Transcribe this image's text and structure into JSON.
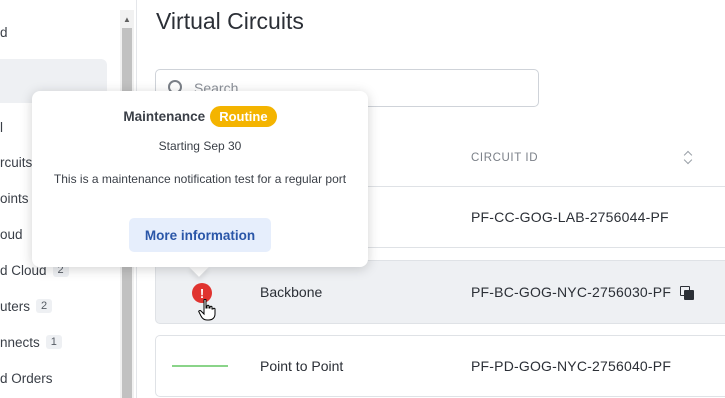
{
  "sidebar": {
    "items": [
      {
        "label": "d",
        "count": ""
      },
      {
        "label": "",
        "count": ""
      },
      {
        "label": "l",
        "count": ""
      },
      {
        "label": "rcuits",
        "count": ""
      },
      {
        "label": "oints",
        "count": ""
      },
      {
        "label": "oud",
        "count": ""
      },
      {
        "label": "d Cloud",
        "count": "2"
      },
      {
        "label": "uters",
        "count": "2"
      },
      {
        "label": "nnects",
        "count": "1"
      },
      {
        "label": "d Orders",
        "count": ""
      }
    ],
    "scroll_up_glyph": "▲"
  },
  "main": {
    "title": "Virtual Circuits",
    "search": {
      "placeholder": "Search",
      "value": ""
    },
    "columns": {
      "circuit_id": "CIRCUIT ID"
    },
    "rows": [
      {
        "type": "",
        "circuit_id": "PF-CC-GOG-LAB-2756044-PF",
        "status": "none"
      },
      {
        "type": "Backbone",
        "circuit_id": "PF-BC-GOG-NYC-2756030-PF",
        "status": "alert-icon"
      },
      {
        "type": "Point to Point",
        "circuit_id": "PF-PD-GOG-NYC-2756040-PF",
        "status": "active-line"
      }
    ]
  },
  "tooltip": {
    "title": "Maintenance",
    "badge": "Routine",
    "start": "Starting Sep 30",
    "description": "This is a maintenance notification test for a regular port",
    "button": "More information"
  },
  "colors": {
    "badge": "#f4b400",
    "alert": "#e0332f",
    "status_line": "#8ad489",
    "button_bg": "#e6eefc",
    "button_text": "#2a56a8"
  }
}
